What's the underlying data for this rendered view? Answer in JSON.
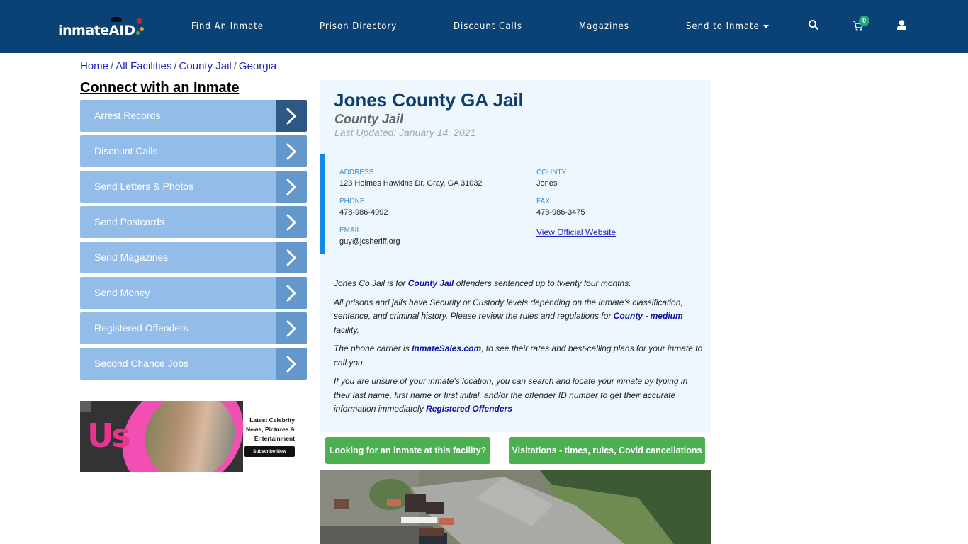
{
  "header": {
    "logo_text": "inmate",
    "logo_accent": "AID",
    "nav": [
      {
        "label": "Find An Inmate"
      },
      {
        "label": "Prison Directory"
      },
      {
        "label": "Discount Calls"
      },
      {
        "label": "Magazines"
      },
      {
        "label": "Send to Inmate",
        "has_dropdown": true
      }
    ],
    "icons": [
      "search-icon",
      "cart-icon",
      "user-icon"
    ],
    "cart_count": "0",
    "colors": {
      "nav_bg": "#0b4275",
      "badge": "#1fa67a"
    }
  },
  "breadcrumb": [
    {
      "label": "Home"
    },
    {
      "label": "All Facilities"
    },
    {
      "label": "County Jail"
    },
    {
      "label": "Georgia"
    }
  ],
  "sidebar": {
    "title": "Connect with an Inmate",
    "items": [
      {
        "label": "Arrest Records",
        "active": true
      },
      {
        "label": "Discount Calls"
      },
      {
        "label": "Send Letters & Photos"
      },
      {
        "label": "Send Postcards"
      },
      {
        "label": "Send Magazines"
      },
      {
        "label": "Send Money"
      },
      {
        "label": "Registered Offenders"
      },
      {
        "label": "Second Chance Jobs"
      }
    ],
    "ad": {
      "brand": "Us",
      "tagline_1": "Latest Celebrity",
      "tagline_2": "News, Pictures &",
      "tagline_3": "Entertainment",
      "button": "Subscribe Now"
    }
  },
  "facility": {
    "name": "Jones County GA Jail",
    "type": "County Jail",
    "last_updated": "Last Updated: January 14, 2021",
    "fields": {
      "address_label": "ADDRESS",
      "address": "123 Holmes Hawkins Dr, Gray, GA 31032",
      "county_label": "COUNTY",
      "county": "Jones",
      "phone_label": "PHONE",
      "phone": "478-986-4992",
      "fax_label": "FAX",
      "fax": "478-986-3475",
      "email_label": "EMAIL",
      "email": "guy@jcsheriff.org",
      "website_link": "View Official Website"
    },
    "description": {
      "p1_a": "Jones Co Jail is for ",
      "p1_link": "County Jail",
      "p1_b": " offenders sentenced up to twenty four months.",
      "p2_a": "All prisons and jails have Security or Custody levels depending on the inmate’s classification, sentence, and criminal history. Please review the rules and regulations for ",
      "p2_link": "County - medium",
      "p2_b": " facility.",
      "p3_a": "The phone carrier is ",
      "p3_link": "InmateSales.com",
      "p3_b": ", to see their rates and best-calling plans for your inmate to call you.",
      "p4_a": "If you are unsure of your inmate's location, you can search and locate your inmate by typing in their last name, first name or first initial, and/or the offender ID number to get their accurate information immediately ",
      "p4_link": "Registered Offenders"
    }
  },
  "actions": {
    "find_inmate": "Looking for an inmate at this facility?",
    "visitations": "Visitations - times, rules, Covid cancellations"
  }
}
